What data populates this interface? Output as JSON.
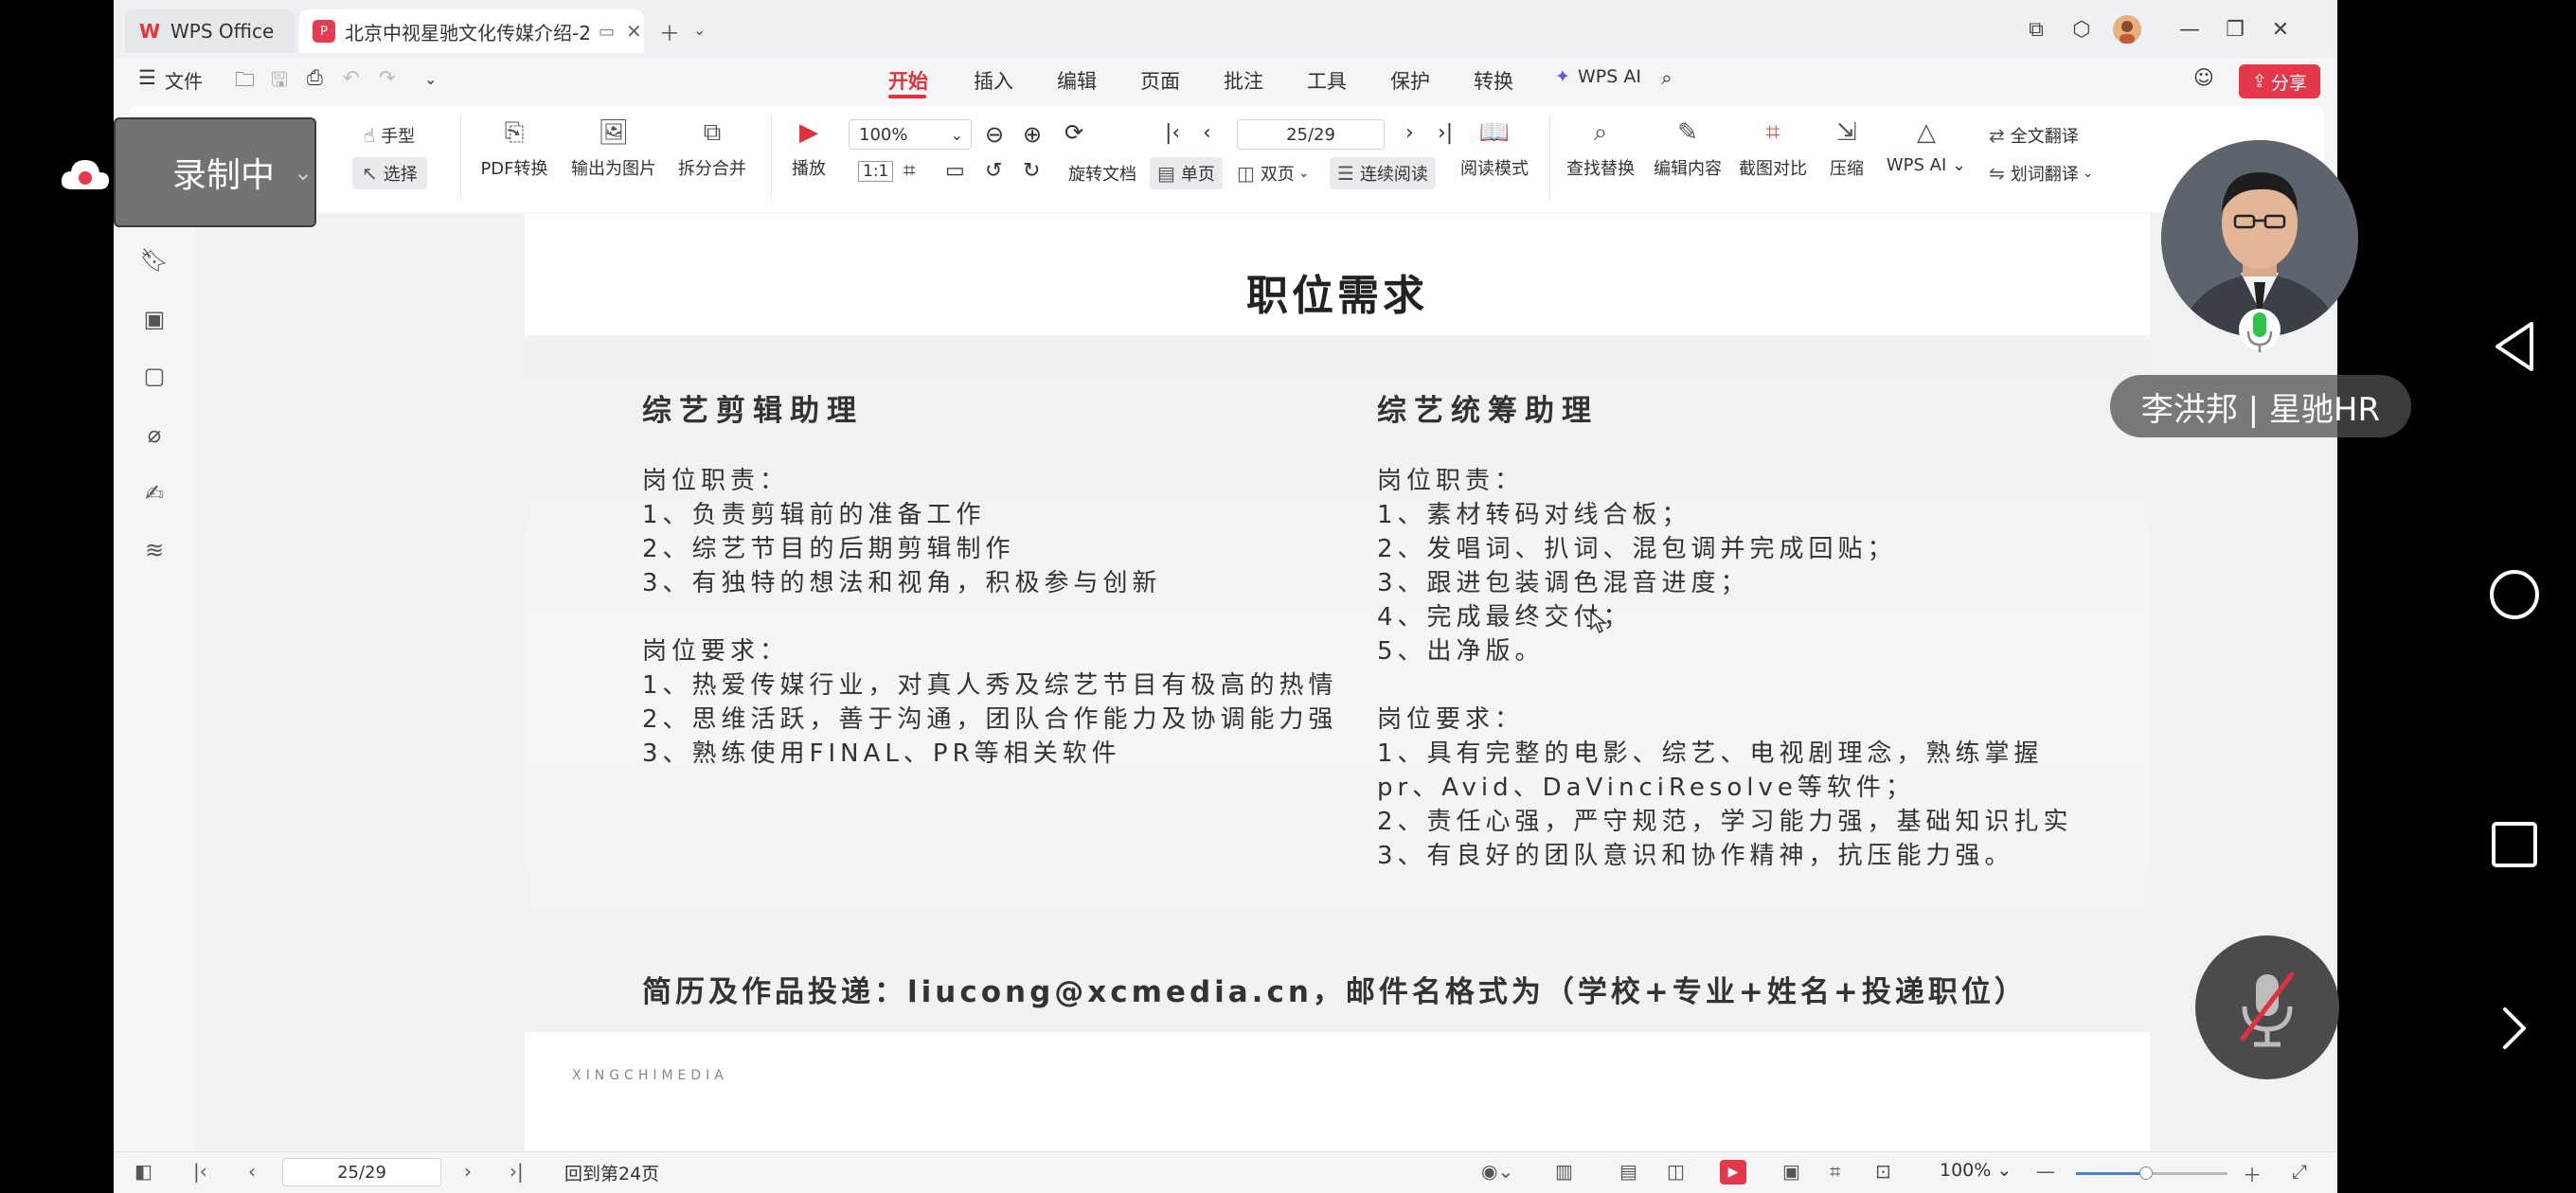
{
  "tabs": [
    {
      "label": "WPS Office"
    },
    {
      "label": "北京中视星驰文化传媒介绍-2..."
    }
  ],
  "menu": {
    "file": "文件",
    "items": [
      "开始",
      "插入",
      "编辑",
      "页面",
      "批注",
      "工具",
      "保护",
      "转换",
      "WPS AI"
    ],
    "share": "分享"
  },
  "ribbon": {
    "hand": "手型",
    "select": "选择",
    "pdf_convert": "PDF转换",
    "export_image": "输出为图片",
    "split_merge": "拆分合并",
    "play": "播放",
    "zoom_value": "100%",
    "rotate": "旋转文档",
    "single_page": "单页",
    "double_page": "双页",
    "continuous": "连续阅读",
    "page_input": "25/29",
    "read_mode": "阅读模式",
    "find_replace": "查找替换",
    "edit_content": "编辑内容",
    "screenshot_compare": "截图对比",
    "compress": "压缩",
    "wps_ai": "WPS AI",
    "full_translate": "全文翻译",
    "word_translate": "划词翻译"
  },
  "recording": {
    "label": "录制中"
  },
  "document": {
    "title": "职位需求",
    "left": {
      "heading": "综艺剪辑助理",
      "duty_title": "岗位职责：",
      "duties": [
        "1、负责剪辑前的准备工作",
        "2、综艺节目的后期剪辑制作",
        "3、有独特的想法和视角，积极参与创新"
      ],
      "req_title": "岗位要求：",
      "reqs": [
        "1、热爱传媒行业，对真人秀及综艺节目有极高的热情",
        "2、思维活跃，善于沟通，团队合作能力及协调能力强",
        "3、熟练使用FINAL、PR等相关软件"
      ]
    },
    "right": {
      "heading": "综艺统筹助理",
      "duty_title": "岗位职责：",
      "duties": [
        "1、素材转码对线合板；",
        "2、发唱词、扒词、混包调并完成回贴；",
        "3、跟进包装调色混音进度；",
        "4、完成最终交付；",
        "5、出净版。"
      ],
      "req_title": "岗位要求：",
      "reqs": [
        "1、具有完整的电影、综艺、电视剧理念，熟练掌握",
        "pr、Avid、DaVinciResolve等软件；",
        "2、责任心强，严守规范，学习能力强，基础知识扎实",
        "3、有良好的团队意识和协作精神，抗压能力强。"
      ]
    },
    "contact": "简历及作品投递：liucong@xcmedia.cn，邮件名格式为（学校+专业+姓名+投递职位）",
    "brand": "XINGCHIMEDIA"
  },
  "statusbar": {
    "page_input": "25/29",
    "back_to": "回到第24页",
    "zoom": "100%",
    "zoom_level_fraction": 0.46
  },
  "presenter": {
    "name": "李洪邦 | 星驰HR"
  },
  "colors": {
    "accent": "#e0323c",
    "share": "#e5374a"
  }
}
